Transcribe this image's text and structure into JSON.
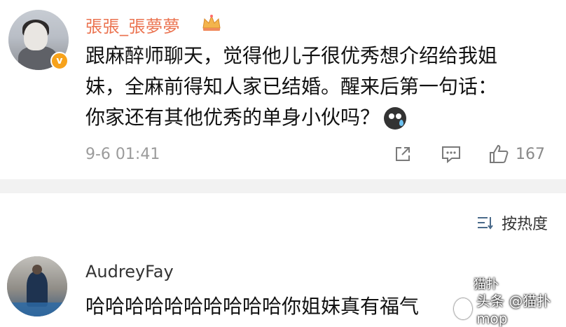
{
  "post": {
    "username": "張張_張夢夢",
    "badge_icon": "crown-icon",
    "verified_icon": "v-verified-icon",
    "text_line1": "跟麻醉师聊天，觉得他儿子很优秀想介绍给我姐",
    "text_line2": "妹，全麻前得知人家已结婚。醒来后第一句话：",
    "text_line3": "你家还有其他优秀的单身小伙吗？",
    "emoji_icon": "crying-face-emoji",
    "timestamp": "9-6 01:41",
    "like_count": "167"
  },
  "comments": {
    "sort_label": "按热度",
    "reply": {
      "username": "AudreyFay",
      "text": "哈哈哈哈哈哈哈哈哈哈你姐妹真有福气"
    }
  },
  "watermark": {
    "text": "头条 @猫扑mop",
    "text2": "猫扑"
  },
  "colors": {
    "username_orange": "#eb7350",
    "verified_badge": "#f7a21b",
    "sort_blue": "#4a6a8a"
  }
}
